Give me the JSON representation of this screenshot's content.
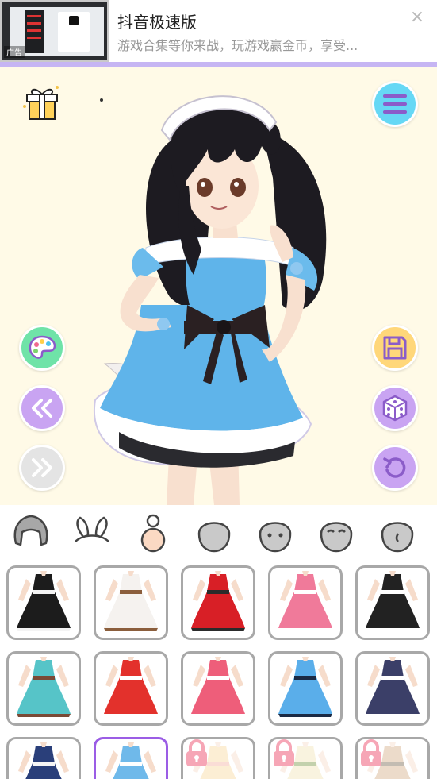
{
  "ad": {
    "title": "抖音极速版",
    "subtitle": "游戏合集等你来战，玩游戏赢金币，享受...",
    "label": "广告",
    "close": "×"
  },
  "stage": {
    "left_buttons": [
      "palette-icon",
      "rewind-icon",
      "fast-forward-icon"
    ],
    "right_buttons": [
      "menu-icon",
      "save-icon",
      "dice-icon",
      "undo-icon"
    ]
  },
  "tabs": [
    "hair-tab",
    "ears-tab",
    "body-tab",
    "face-tab-1",
    "face-tab-2",
    "face-tab-3",
    "face-tab-4"
  ],
  "outfits": [
    {
      "name": "outfit-bunny-black",
      "colors": [
        "#1c1c1c",
        "#f4f4f4"
      ],
      "locked": false
    },
    {
      "name": "outfit-bunny-white",
      "colors": [
        "#f5f2ef",
        "#8b5e3c"
      ],
      "locked": false
    },
    {
      "name": "outfit-bunny-red",
      "colors": [
        "#d81f26",
        "#2b2b2b"
      ],
      "locked": false
    },
    {
      "name": "outfit-maid-pink",
      "colors": [
        "#f07a9a",
        "#ffffff"
      ],
      "locked": false
    },
    {
      "name": "outfit-gothic-black",
      "colors": [
        "#222222",
        "#ffffff"
      ],
      "locked": false
    },
    {
      "name": "outfit-teal-dress",
      "colors": [
        "#56c4c8",
        "#7a4a36"
      ],
      "locked": false
    },
    {
      "name": "outfit-red-maid",
      "colors": [
        "#e3312c",
        "#ffffff"
      ],
      "locked": false
    },
    {
      "name": "outfit-pink-dress",
      "colors": [
        "#ee5e7a",
        "#ffffff"
      ],
      "locked": false
    },
    {
      "name": "outfit-blue-dress",
      "colors": [
        "#5aaeea",
        "#1b2a44"
      ],
      "locked": false
    },
    {
      "name": "outfit-sailor-navy",
      "colors": [
        "#3b3f68",
        "#ffffff"
      ],
      "locked": false
    },
    {
      "name": "outfit-navy-jacket",
      "colors": [
        "#2a3f7a",
        "#f5f5f5"
      ],
      "locked": false
    },
    {
      "name": "outfit-blue-maid",
      "colors": [
        "#6fb9ea",
        "#ffffff"
      ],
      "locked": false
    },
    {
      "name": "outfit-peach",
      "colors": [
        "#f8d9a0",
        "#f4b4a4"
      ],
      "locked": true
    },
    {
      "name": "outfit-cream",
      "colors": [
        "#f1e4b8",
        "#7a9a4a"
      ],
      "locked": true
    },
    {
      "name": "outfit-khaki",
      "colors": [
        "#d6b08a",
        "#7a6a54"
      ],
      "locked": true
    }
  ],
  "colors": {
    "accent_purple": "#c9a4f2",
    "menu_cyan": "#66d8f5",
    "palette_green": "#6fe3a8",
    "save_yellow": "#ffd77a",
    "stage_bg": "#fffae7",
    "selected_border": "#9b5de5",
    "lock_pink": "#f6a6b6"
  }
}
